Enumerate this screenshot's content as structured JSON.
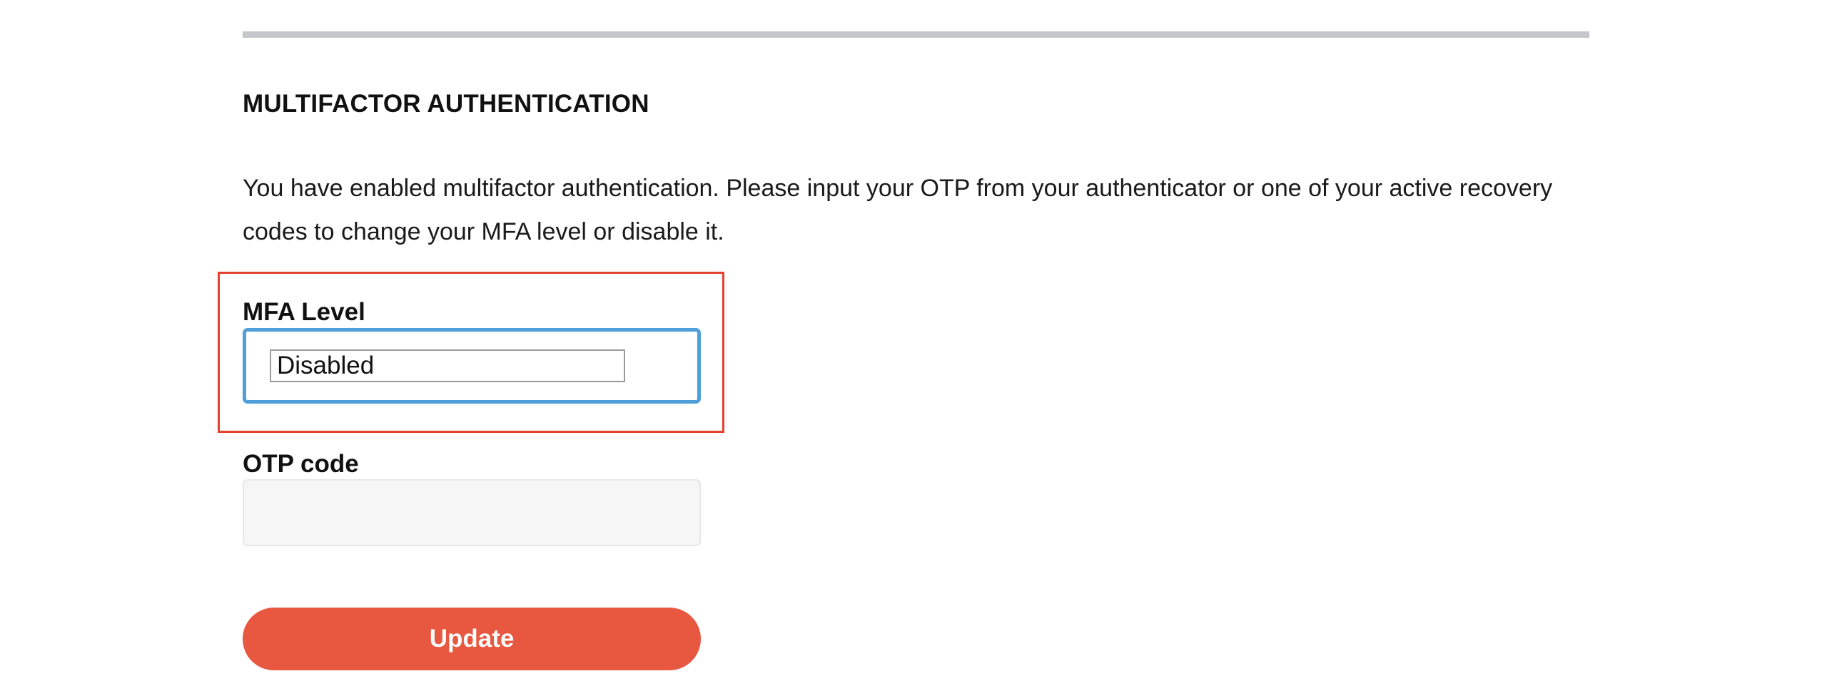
{
  "section": {
    "title": "MULTIFACTOR AUTHENTICATION",
    "description": "You have enabled multifactor authentication. Please input your OTP from your authenticator or one of your active recovery codes to change your MFA level or disable it."
  },
  "mfa_level": {
    "label": "MFA Level",
    "selected_value": "Disabled"
  },
  "otp": {
    "label": "OTP code",
    "value": "",
    "placeholder": ""
  },
  "actions": {
    "update_label": "Update"
  },
  "colors": {
    "accent": "#e8573f",
    "focus_border": "#4f9fdb",
    "highlight": "#e5412f",
    "divider": "#c4c6cb"
  }
}
